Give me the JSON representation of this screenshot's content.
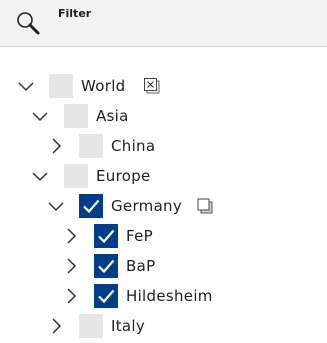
{
  "filter": {
    "label": "Filter",
    "search_icon": "search-icon"
  },
  "tree": {
    "world": {
      "label": "World",
      "expanded": true,
      "checked": false,
      "action_icon": "clear-selection-icon"
    },
    "asia": {
      "label": "Asia",
      "expanded": true,
      "checked": false
    },
    "china": {
      "label": "China",
      "expanded": false,
      "checked": false
    },
    "europe": {
      "label": "Europe",
      "expanded": true,
      "checked": false
    },
    "germany": {
      "label": "Germany",
      "expanded": true,
      "checked": true,
      "action_icon": "copy-selection-icon"
    },
    "fep": {
      "label": "FeP",
      "expanded": false,
      "checked": true
    },
    "bap": {
      "label": "BaP",
      "expanded": false,
      "checked": true
    },
    "hildesheim": {
      "label": "Hildesheim",
      "expanded": false,
      "checked": true
    },
    "italy": {
      "label": "Italy",
      "expanded": false,
      "checked": false
    }
  },
  "colors": {
    "checked": "#003f87",
    "unchecked": "#e6e6e6",
    "header_bg": "#f2f2f2"
  }
}
